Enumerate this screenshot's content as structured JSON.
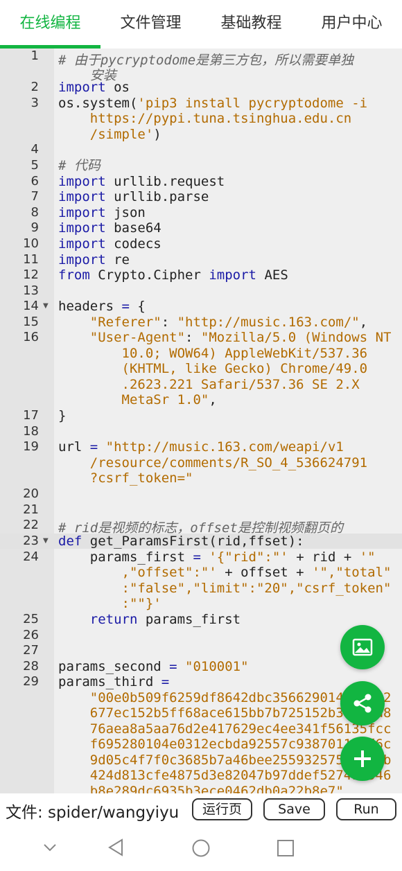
{
  "tabs": [
    {
      "label": "在线编程",
      "active": true
    },
    {
      "label": "文件管理"
    },
    {
      "label": "基础教程"
    },
    {
      "label": "用户中心"
    }
  ],
  "editor": {
    "line_numbers": [
      "1",
      "2",
      "3",
      "4",
      "5",
      "6",
      "7",
      "8",
      "9",
      "10",
      "11",
      "12",
      "13",
      "14",
      "15",
      "16",
      "17",
      "18",
      "19",
      "20",
      "21",
      "22",
      "23",
      "24",
      "25",
      "26",
      "27",
      "28",
      "29"
    ],
    "lines": {
      "l1a": "# 由于pycryptodome是第三方包，所以需要单独",
      "l1b": "    安装",
      "l2_kw": "import",
      "l2": " os",
      "l3a": "os.system(",
      "l3s1": "'pip3 install pycryptodome -i",
      "l3s2": "    https://pypi.tuna.tsinghua.edu.cn",
      "l3s3": "    /simple'",
      "l3end": ")",
      "l5": "# 代码",
      "l6_kw": "import",
      "l6": " urllib.request",
      "l7_kw": "import",
      "l7": " urllib.parse",
      "l8_kw": "import",
      "l8": " json",
      "l9_kw": "import",
      "l9": " base64",
      "l10_kw": "import",
      "l10": " codecs",
      "l11_kw": "import",
      "l11": " re",
      "l12_kw1": "from",
      "l12_mid": " Crypto.Cipher ",
      "l12_kw2": "import",
      "l12_end": " AES",
      "l14a": "headers ",
      "l14op": "=",
      "l14b": " {",
      "l15_key": "    \"Referer\"",
      "l15_colon": ": ",
      "l15_val": "\"http://music.163.com/\"",
      "l15_end": ",",
      "l16_key": "    \"User-Agent\"",
      "l16_colon": ": ",
      "l16_v1": "\"Mozilla/5.0 (Windows NT",
      "l16_v2": "        10.0; WOW64) AppleWebKit/537.36",
      "l16_v3": "        (KHTML, like Gecko) Chrome/49.0",
      "l16_v4": "        .2623.221 Safari/537.36 SE 2.X",
      "l16_v5": "        MetaSr 1.0\"",
      "l16_end": ",",
      "l17": "}",
      "l19a": "url ",
      "l19op": "=",
      "l19s1": " \"http://music.163.com/weapi/v1",
      "l19s2": "    /resource/comments/R_SO_4_536624791",
      "l19s3": "    ?csrf_token=\"",
      "l22": "# rid是视频的标志，offset是控制视频翻页的",
      "l23_kw": "def",
      "l23": " get_ParamsFirst(rid,ffset):",
      "l24a": "    params_first ",
      "l24op": "=",
      "l24s1": " '{\"rid\":\"'",
      "l24p1": " + rid + ",
      "l24s2": "'\"",
      "l24s3": "        ,\"offset\":\"'",
      "l24p2": " + offset + ",
      "l24s4": "'\",\"total\"",
      "l24s5": "        :\"false\",\"limit\":\"20\",\"csrf_token\"",
      "l24s6": "        :\"\"}'",
      "l25_kw": "    return",
      "l25": " params_first",
      "l28a": "params_second ",
      "l28op": "=",
      "l28s": " \"010001\"",
      "l29a": "params_third ",
      "l29op": "=",
      "l29s1": "    \"00e0b509f6259df8642dbc35662901477df22",
      "l29s2": "    677ec152b5ff68ace615bb7b725152b3ab17a8",
      "l29s3": "    76aea8a5aa76d2e417629ec4ee341f56135fcc",
      "l29s4": "    f695280104e0312ecbda92557c93870114af6c",
      "l29s5": "    9d05c4f7f0c3685b7a46bee255932575cce10b",
      "l29s6": "    424d813cfe4875d3e82047b97ddef52741d546",
      "l29s7": "    b8e289dc6935b3ece0462db0a22b8e7\""
    }
  },
  "bottom": {
    "file_label": "文件: spider/wangyiyu",
    "run_page_label": "运行页",
    "save_label": "Save",
    "run_label": "Run"
  },
  "colors": {
    "accent": "#12b541",
    "keyword": "#1a1aa6",
    "string": "#b26b00"
  },
  "icons": {
    "fab1": "image-icon",
    "fab2": "share-icon",
    "fab3": "plus-icon",
    "nav": [
      "chevron-down-icon",
      "back-triangle-icon",
      "home-circle-icon",
      "recents-square-icon"
    ]
  }
}
